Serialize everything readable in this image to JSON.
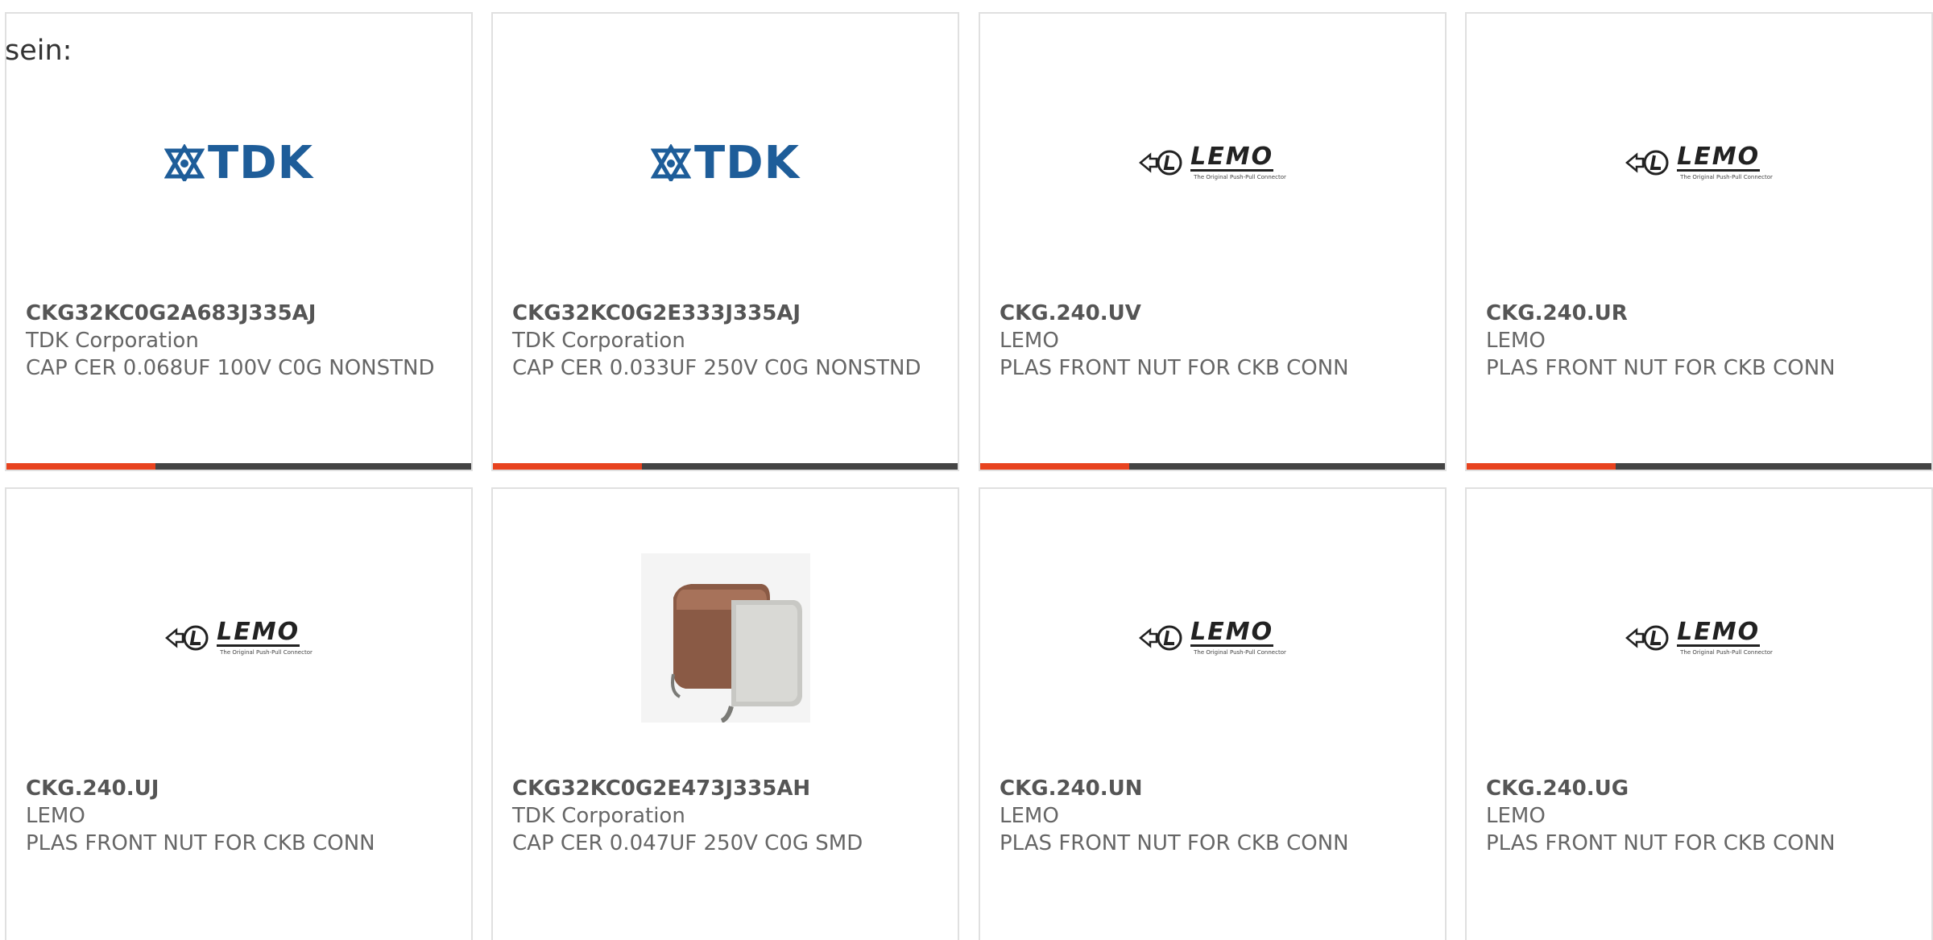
{
  "intro_text": "sein:",
  "brand_colors": {
    "progress_fill": "#e8431f",
    "progress_track": "#444444",
    "tdk_blue": "#1e5d99"
  },
  "cards": [
    {
      "part_number": "CKG32KC0G2A683J335AJ",
      "manufacturer": "TDK Corporation",
      "description": "CAP CER 0.068UF 100V C0G NONSTND",
      "image": "tdk-logo",
      "progress": 0.32
    },
    {
      "part_number": "CKG32KC0G2E333J335AJ",
      "manufacturer": "TDK Corporation",
      "description": "CAP CER 0.033UF 250V C0G NONSTND",
      "image": "tdk-logo",
      "progress": 0.32
    },
    {
      "part_number": "CKG.240.UV",
      "manufacturer": "LEMO",
      "description": "PLAS FRONT NUT FOR CKB CONN",
      "image": "lemo-logo",
      "progress": 0.32
    },
    {
      "part_number": "CKG.240.UR",
      "manufacturer": "LEMO",
      "description": "PLAS FRONT NUT FOR CKB CONN",
      "image": "lemo-logo",
      "progress": 0.32
    },
    {
      "part_number": "CKG.240.UJ",
      "manufacturer": "LEMO",
      "description": "PLAS FRONT NUT FOR CKB CONN",
      "image": "lemo-logo"
    },
    {
      "part_number": "CKG32KC0G2E473J335AH",
      "manufacturer": "TDK Corporation",
      "description": "CAP CER 0.047UF 250V C0G SMD",
      "image": "capacitor-photo"
    },
    {
      "part_number": "CKG.240.UN",
      "manufacturer": "LEMO",
      "description": "PLAS FRONT NUT FOR CKB CONN",
      "image": "lemo-logo"
    },
    {
      "part_number": "CKG.240.UG",
      "manufacturer": "LEMO",
      "description": "PLAS FRONT NUT FOR CKB CONN",
      "image": "lemo-logo"
    }
  ],
  "logos": {
    "tdk_wordmark": "TDK",
    "lemo_wordmark": "LEMO",
    "lemo_tagline": "The Original Push-Pull Connector"
  }
}
